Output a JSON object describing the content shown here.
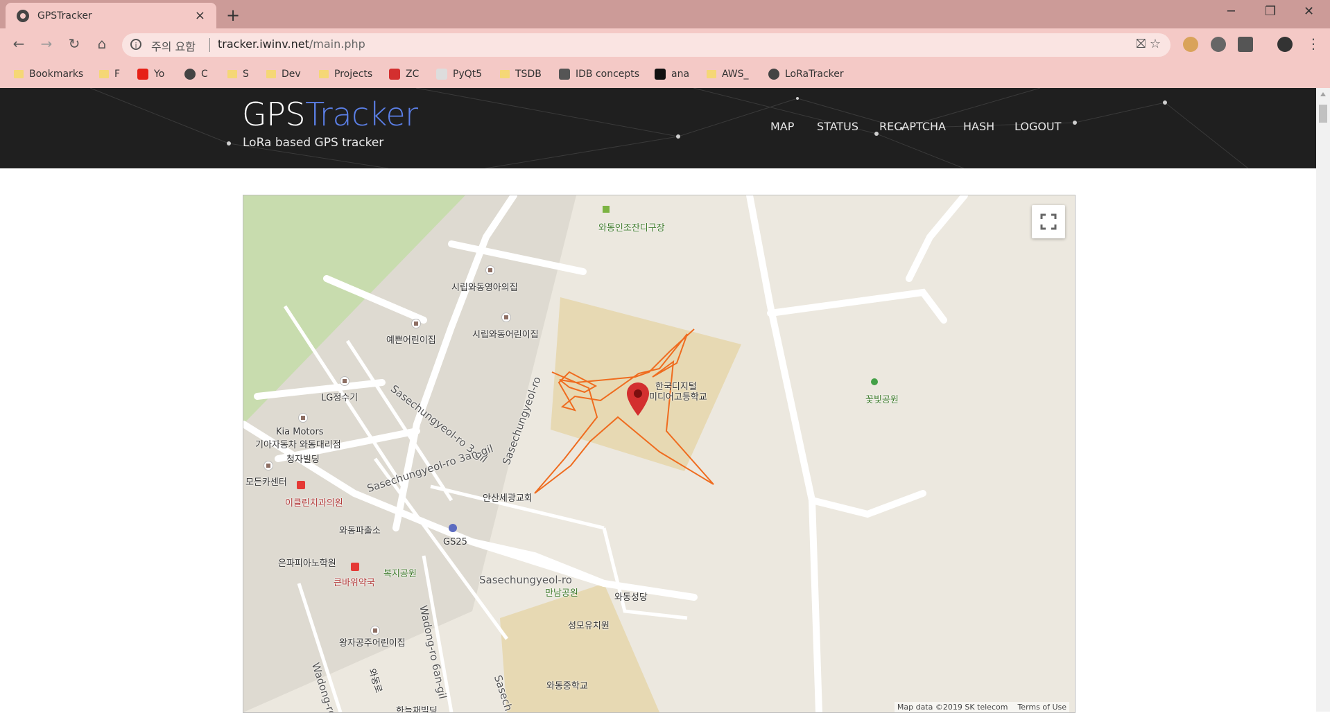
{
  "browser": {
    "tab_title": "GPSTracker",
    "close_glyph": "×",
    "new_tab_glyph": "+",
    "window_controls": {
      "minimize": "─",
      "restore": "❐",
      "close": "✕"
    },
    "nav": {
      "back": "←",
      "forward": "→",
      "reload": "↻",
      "home": "⌂"
    },
    "info_glyph": "i",
    "security_warning": "주의 요함",
    "url_host": "tracker.iwinv.net",
    "url_path": "/main.php",
    "omnibox_icons": "⛝  ☆",
    "menu_glyph": "⋮",
    "bookmarks": [
      {
        "label": "Bookmarks",
        "icon": "folder"
      },
      {
        "label": "F",
        "icon": "folder"
      },
      {
        "label": "Yo",
        "icon": "youtube-icon"
      },
      {
        "label": "C",
        "icon": "globe-icon"
      },
      {
        "label": "S",
        "icon": "folder"
      },
      {
        "label": "Dev",
        "icon": "folder"
      },
      {
        "label": "Projects",
        "icon": "folder"
      },
      {
        "label": "ZC",
        "icon": "zc-icon"
      },
      {
        "label": "PyQt5",
        "icon": "wiki-icon"
      },
      {
        "label": "TSDB",
        "icon": "folder"
      },
      {
        "label": "IDB concepts",
        "icon": "influx-icon"
      },
      {
        "label": "ana",
        "icon": "play-icon"
      },
      {
        "label": "AWS_",
        "icon": "folder"
      },
      {
        "label": "LoRaTracker",
        "icon": "globe-icon"
      }
    ]
  },
  "site": {
    "brand_part1": "GPS",
    "brand_part2": "Tracker",
    "tagline": "LoRa based GPS tracker",
    "menu": [
      "MAP",
      "STATUS",
      "RECAPTCHA",
      "HASH",
      "LOGOUT"
    ],
    "accent_color": "#5b7fe6"
  },
  "map": {
    "labels": {
      "golf": "와동인조잔디구장",
      "daycare1": "시립와동영아의집",
      "daycare2": "예쁜어린이집",
      "daycare3": "시립와동어린이집",
      "road1": "Sasechungyeol-ro 3-gil",
      "road2": "Sasechungyeol-ro",
      "lg": "LG정수기",
      "kia1": "Kia Motors",
      "kia2": "기아자동차 와동대리점",
      "school_hi_1": "한국디지털",
      "school_hi_2": "미디어고등학교",
      "park1": "꽃빛공원",
      "cheongja": "청자빌딩",
      "road3": "Sasechungyeol-ro 3an-gil",
      "modeun": "모든카센터",
      "dental": "이클린치과의원",
      "church": "안산세광교회",
      "police": "와동파출소",
      "gs25": "GS25",
      "piano": "은파피아노학원",
      "pharmacy": "큰바위약국",
      "welfare_park": "복지공원",
      "road4": "Sasechungyeol-ro",
      "mannam": "만남공원",
      "catholic": "와동성당",
      "kinder": "성모유치원",
      "road5": "Wadong-ro 6an-gil",
      "princess": "왕자공주어린이집",
      "road6": "Wadong-ro",
      "wadong": "와동로",
      "middle": "와동중학교",
      "hanul": "한늘채빌딩",
      "road7": "Sasech"
    },
    "attribution": "Map data ©2019 SK telecom",
    "terms": "Terms of Use",
    "track_color": "#ef6c1f",
    "marker_color": "#d32f2f"
  }
}
